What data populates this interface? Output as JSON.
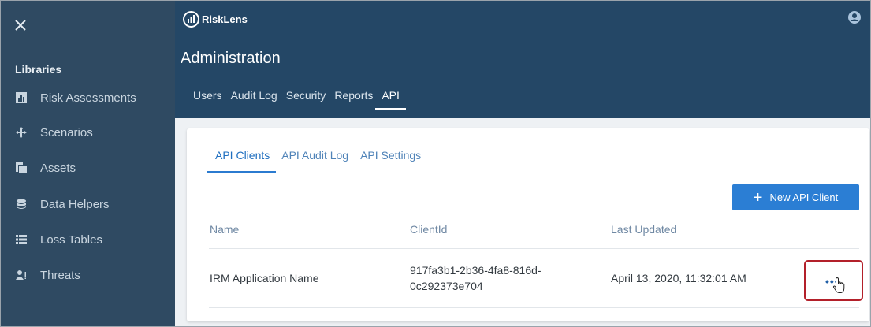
{
  "brand": {
    "name": "RiskLens"
  },
  "sidebar": {
    "header": "Libraries",
    "items": [
      {
        "label": "Risk Assessments",
        "icon": "chart-box-icon"
      },
      {
        "label": "Scenarios",
        "icon": "move-arrows-icon"
      },
      {
        "label": "Assets",
        "icon": "stacked-layers-icon"
      },
      {
        "label": "Data Helpers",
        "icon": "database-icon"
      },
      {
        "label": "Loss Tables",
        "icon": "table-list-icon"
      },
      {
        "label": "Threats",
        "icon": "users-alert-icon"
      }
    ]
  },
  "header": {
    "title": "Administration",
    "tabs": [
      "Users",
      "Audit Log",
      "Security",
      "Reports",
      "API"
    ],
    "active_tab": "API"
  },
  "api": {
    "sub_tabs": [
      "API Clients",
      "API Audit Log",
      "API Settings"
    ],
    "active_sub_tab": "API Clients",
    "new_button": "New API Client",
    "columns": [
      "Name",
      "ClientId",
      "Last Updated"
    ],
    "rows": [
      {
        "name": "IRM Application Name",
        "client_id_line1": "917fa3b1-2b36-4fa8-816d-",
        "client_id_line2": "0c292373e704",
        "last_updated": "April 13, 2020, 11:32:01 AM"
      }
    ],
    "more_label": "•••"
  },
  "colors": {
    "sidebar": "#2f4a62",
    "topbar": "#244766",
    "accent": "#2b7ed4",
    "highlight": "#b3202a"
  }
}
